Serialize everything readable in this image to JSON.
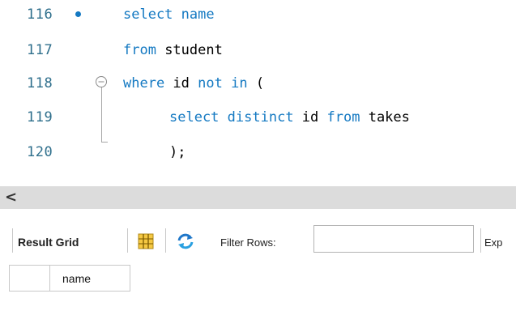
{
  "editor": {
    "lines": [
      {
        "num": "116",
        "tokens": [
          {
            "t": "select",
            "kw": true
          },
          {
            "t": " "
          },
          {
            "t": "name",
            "kw": true
          }
        ]
      },
      {
        "num": "117",
        "tokens": [
          {
            "t": "from",
            "kw": true
          },
          {
            "t": " student"
          }
        ]
      },
      {
        "num": "118",
        "tokens": [
          {
            "t": "where",
            "kw": true
          },
          {
            "t": " id "
          },
          {
            "t": "not",
            "kw": true
          },
          {
            "t": " "
          },
          {
            "t": "in",
            "kw": true
          },
          {
            "t": " ("
          }
        ]
      },
      {
        "num": "119",
        "tokens": [
          {
            "t": "select",
            "kw": true
          },
          {
            "t": " "
          },
          {
            "t": "distinct",
            "kw": true
          },
          {
            "t": " id "
          },
          {
            "t": "from",
            "kw": true
          },
          {
            "t": " takes"
          }
        ]
      },
      {
        "num": "120",
        "tokens": [
          {
            "t": ");"
          }
        ]
      }
    ]
  },
  "scrollbar": {
    "left_arrow": "<"
  },
  "result_toolbar": {
    "result_grid_label": "Result Grid",
    "filter_rows_label": "Filter Rows:",
    "filter_value": "",
    "export_label": "Exp"
  },
  "grid": {
    "columns": [
      "name"
    ]
  },
  "colors": {
    "keyword": "#1479c2",
    "line_number": "#2f6f8c",
    "scrollbar": "#dcdcdc"
  }
}
